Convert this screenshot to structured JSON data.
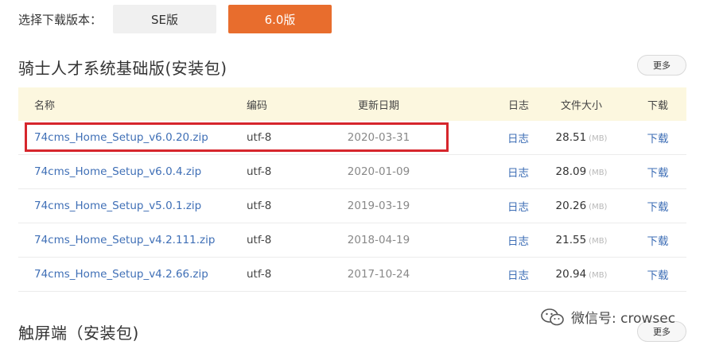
{
  "version_selector": {
    "label": "选择下载版本：",
    "options": [
      "SE版",
      "6.0版"
    ],
    "selected": "6.0版",
    "active_color": "#e86d2d"
  },
  "sections": [
    {
      "title": "骑士人才系统基础版(安装包)",
      "more_label": "更多"
    },
    {
      "title": "触屏端（安装包)",
      "more_label": "更多"
    }
  ],
  "table": {
    "headers": [
      "名称",
      "编码",
      "更新日期",
      "日志",
      "文件大小",
      "下载"
    ],
    "rows": [
      {
        "name": "74cms_Home_Setup_v6.0.20.zip",
        "encoding": "utf-8",
        "date": "2020-03-31",
        "log": "日志",
        "size": "28.51",
        "unit": "(MB)",
        "download": "下载"
      },
      {
        "name": "74cms_Home_Setup_v6.0.4.zip",
        "encoding": "utf-8",
        "date": "2020-01-09",
        "log": "日志",
        "size": "28.09",
        "unit": "(MB)",
        "download": "下载"
      },
      {
        "name": "74cms_Home_Setup_v5.0.1.zip",
        "encoding": "utf-8",
        "date": "2019-03-19",
        "log": "日志",
        "size": "20.26",
        "unit": "(MB)",
        "download": "下载"
      },
      {
        "name": "74cms_Home_Setup_v4.2.111.zip",
        "encoding": "utf-8",
        "date": "2018-04-19",
        "log": "日志",
        "size": "21.55",
        "unit": "(MB)",
        "download": "下载"
      },
      {
        "name": "74cms_Home_Setup_v4.2.66.zip",
        "encoding": "utf-8",
        "date": "2017-10-24",
        "log": "日志",
        "size": "20.94",
        "unit": "(MB)",
        "download": "下载"
      }
    ],
    "header_bg": "#fcf7df",
    "link_color": "#3f6fb6"
  },
  "highlight_color": "#d6262c",
  "watermark": {
    "icon": "wechat-icon",
    "text": "微信号: crowsec"
  }
}
